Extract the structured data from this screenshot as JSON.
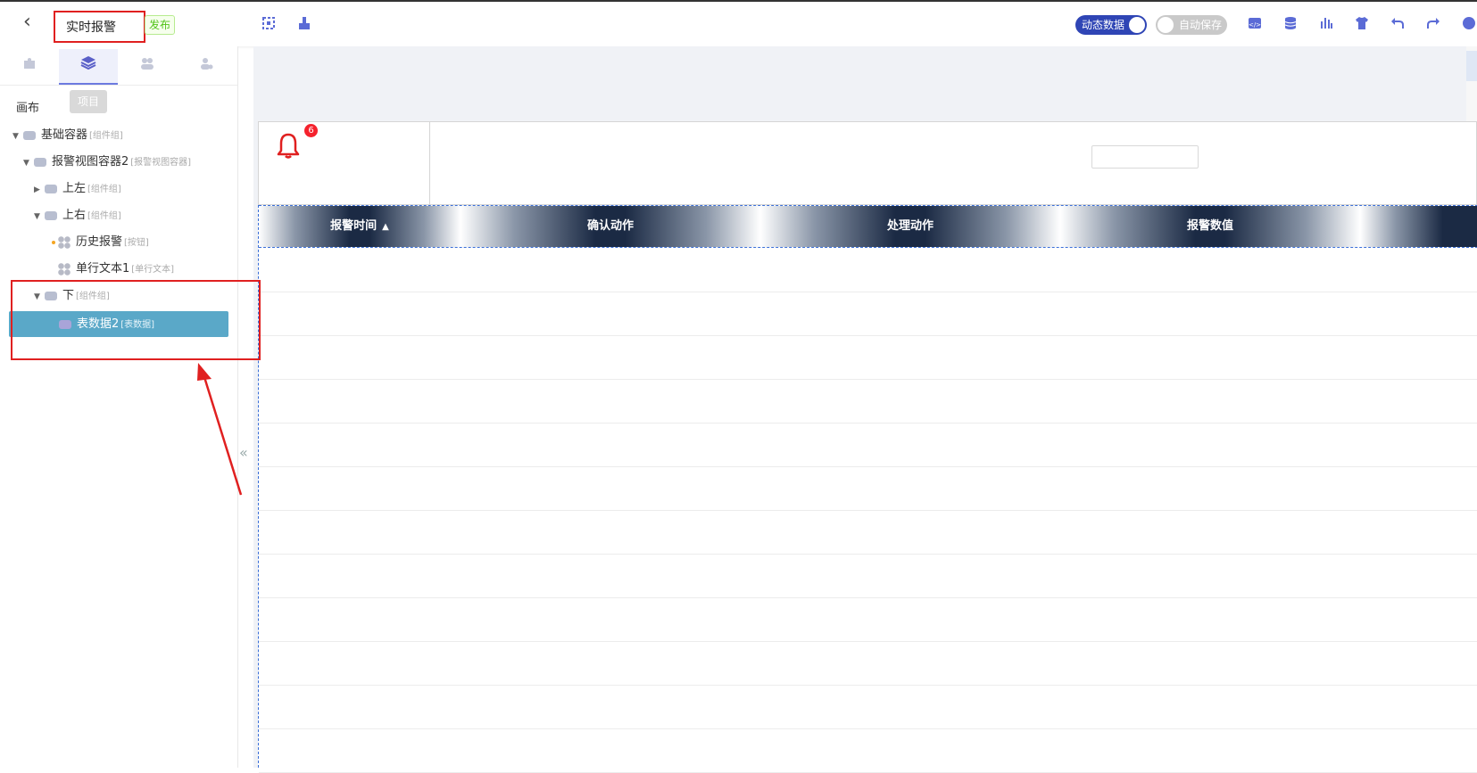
{
  "topbar": {
    "title": "实时报警",
    "publish_label": "发布",
    "dynamic_data_label": "动态数据",
    "auto_save_label": "自动保存",
    "icons": [
      "back-icon",
      "select-icon",
      "brush-icon",
      "code-icon",
      "database-icon",
      "chart-icon",
      "theme-icon",
      "undo-icon",
      "redo-icon"
    ]
  },
  "left_panel": {
    "tooltip": "项目",
    "canvas_label": "画布",
    "tree": [
      {
        "label": "基础容器",
        "tag": "[组件组]"
      },
      {
        "label": "报警视图容器2",
        "tag": "[报警视图容器]"
      },
      {
        "label": "上左",
        "tag": "[组件组]"
      },
      {
        "label": "上右",
        "tag": "[组件组]"
      },
      {
        "label": "历史报警",
        "tag": "[按钮]"
      },
      {
        "label": "单行文本1",
        "tag": "[单行文本]"
      },
      {
        "label": "下",
        "tag": "[组件组]"
      },
      {
        "label": "表数据2",
        "tag": "[表数据]"
      }
    ]
  },
  "alarm": {
    "badge_count": "6"
  },
  "table": {
    "columns": [
      "报警时间",
      "确认动作",
      "处理动作",
      "报警数值"
    ],
    "sorted_column_index": 0,
    "sort_direction": "ascending"
  },
  "colors": {
    "accent": "#2f45b5",
    "selected": "#5aa8c8",
    "badge": "#f5222d",
    "annotation": "#e02020"
  }
}
